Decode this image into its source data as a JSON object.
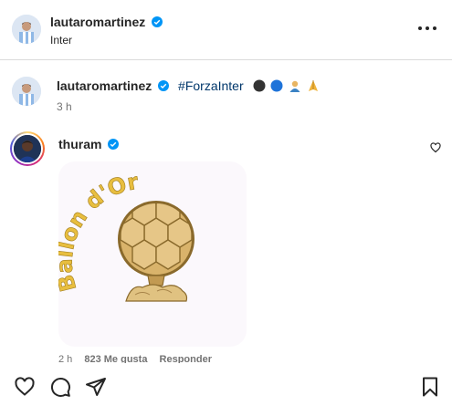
{
  "header": {
    "username": "lautaromartinez",
    "subtitle": "Inter",
    "more_icon": "more-horizontal-icon"
  },
  "caption": {
    "username": "lautaromartinez",
    "hashtag": "#ForzaInter",
    "emojis": [
      "black-circle-emoji",
      "blue-circle-emoji",
      "person-emoji",
      "folded-hands-emoji"
    ],
    "time": "3 h"
  },
  "comment": {
    "username": "thuram",
    "sticker_text": "Ballon d'Or",
    "time": "2 h",
    "likes": "823 Me gusta",
    "reply": "Responder"
  },
  "actions": {
    "icons": [
      "heart-icon",
      "comment-icon",
      "share-icon",
      "save-icon"
    ]
  },
  "colors": {
    "verified": "#0095f6",
    "text": "#262626",
    "muted": "#737373",
    "link": "#00376b",
    "trophy_gold": "#d9b36b"
  }
}
